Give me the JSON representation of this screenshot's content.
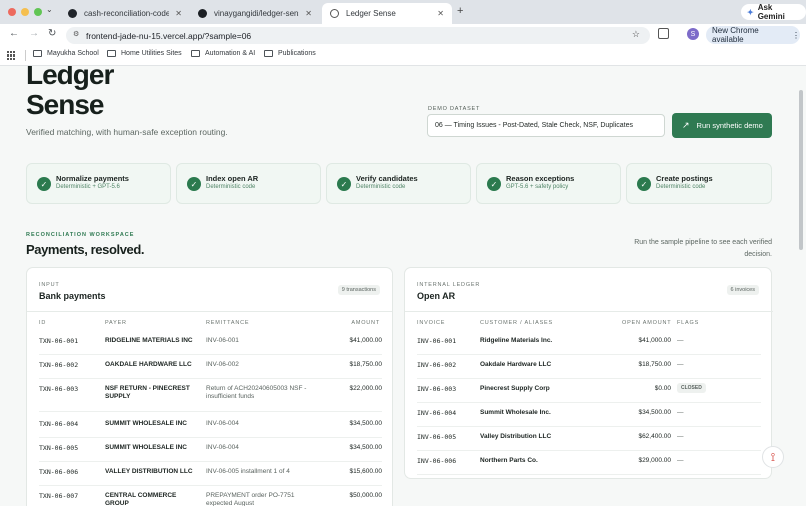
{
  "browser": {
    "tabs": [
      {
        "title": "cash-reconciliation-codex"
      },
      {
        "title": "vinaygangidi/ledger-sense: A"
      },
      {
        "title": "Ledger Sense"
      }
    ],
    "new_tab": "+",
    "ask_gemini": "Ask Gemini",
    "url": "frontend-jade-nu-15.vercel.app/?sample=06",
    "avatar": "S",
    "new_chrome": "New Chrome available",
    "bookmarks": [
      "Mayukha School",
      "Home Utilities Sites",
      "Automation & AI",
      "Publications"
    ]
  },
  "hero": {
    "title_line1": "Ledger",
    "title_line2": "Sense",
    "tagline": "Verified matching, with human-safe exception routing.",
    "demo_label": "DEMO DATASET",
    "demo_value": "06 — Timing Issues - Post-Dated, Stale Check, NSF, Duplicates",
    "run_button": "Run synthetic demo"
  },
  "steps": [
    {
      "title": "Normalize payments",
      "subtitle": "Deterministic + GPT-5.6"
    },
    {
      "title": "Index open AR",
      "subtitle": "Deterministic code"
    },
    {
      "title": "Verify candidates",
      "subtitle": "Deterministic code"
    },
    {
      "title": "Reason exceptions",
      "subtitle": "GPT-5.6 + safety policy"
    },
    {
      "title": "Create postings",
      "subtitle": "Deterministic code"
    }
  ],
  "workspace": {
    "eyebrow": "RECONCILIATION WORKSPACE",
    "title": "Payments, resolved.",
    "hint_line1": "Run the sample pipeline to see each verified",
    "hint_line2": "decision."
  },
  "bank": {
    "eyebrow": "INPUT",
    "title": "Bank payments",
    "count": "9 transactions",
    "columns": [
      "ID",
      "PAYER",
      "REMITTANCE",
      "AMOUNT"
    ],
    "rows": [
      {
        "id": "TXN-06-001",
        "payer": "RIDGELINE MATERIALS INC",
        "payer2": "",
        "remit": "INV-06-001",
        "remit2": "",
        "amount": "$41,000.00"
      },
      {
        "id": "TXN-06-002",
        "payer": "OAKDALE HARDWARE LLC",
        "payer2": "",
        "remit": "INV-06-002",
        "remit2": "",
        "amount": "$18,750.00"
      },
      {
        "id": "TXN-06-003",
        "payer": "NSF RETURN - PINECREST",
        "payer2": "SUPPLY",
        "remit": "Return of ACH20240605003 NSF -",
        "remit2": "insufficient funds",
        "amount": "$22,000.00"
      },
      {
        "id": "TXN-06-004",
        "payer": "SUMMIT WHOLESALE INC",
        "payer2": "",
        "remit": "INV-06-004",
        "remit2": "",
        "amount": "$34,500.00"
      },
      {
        "id": "TXN-06-005",
        "payer": "SUMMIT WHOLESALE INC",
        "payer2": "",
        "remit": "INV-06-004",
        "remit2": "",
        "amount": "$34,500.00"
      },
      {
        "id": "TXN-06-006",
        "payer": "VALLEY DISTRIBUTION LLC",
        "payer2": "",
        "remit": "INV-06-005 installment 1 of 4",
        "remit2": "",
        "amount": "$15,600.00"
      },
      {
        "id": "TXN-06-007",
        "payer": "CENTRAL COMMERCE",
        "payer2": "GROUP",
        "remit": "PREPAYMENT order PO-7751",
        "remit2": "expected August",
        "amount": "$50,000.00"
      }
    ]
  },
  "ledger": {
    "eyebrow": "INTERNAL LEDGER",
    "title": "Open AR",
    "count": "6 invoices",
    "columns": [
      "INVOICE",
      "CUSTOMER / ALIASES",
      "OPEN AMOUNT",
      "FLAGS"
    ],
    "rows": [
      {
        "inv": "INV-06-001",
        "customer": "Ridgeline Materials Inc.",
        "amount": "$41,000.00",
        "flag": "—"
      },
      {
        "inv": "INV-06-002",
        "customer": "Oakdale Hardware LLC",
        "amount": "$18,750.00",
        "flag": "—"
      },
      {
        "inv": "INV-06-003",
        "customer": "Pinecrest Supply Corp",
        "amount": "$0.00",
        "flag": "CLOSED"
      },
      {
        "inv": "INV-06-004",
        "customer": "Summit Wholesale Inc.",
        "amount": "$34,500.00",
        "flag": "—"
      },
      {
        "inv": "INV-06-005",
        "customer": "Valley Distribution LLC",
        "amount": "$62,400.00",
        "flag": "—"
      },
      {
        "inv": "INV-06-006",
        "customer": "Northern Parts Co.",
        "amount": "$29,000.00",
        "flag": "—"
      }
    ]
  },
  "colors": {
    "accent": "#2f7a52",
    "mint": "#f1f7f3"
  },
  "icons": [
    "chevron-down-icon",
    "back-icon",
    "forward-icon",
    "reload-icon",
    "site-info-icon",
    "star-icon",
    "extensions-icon",
    "kebab-icon",
    "apps-grid-icon",
    "folder-icon",
    "check-icon",
    "arrow-up-right-icon",
    "pdf-icon",
    "gemini-sparkle-icon"
  ]
}
